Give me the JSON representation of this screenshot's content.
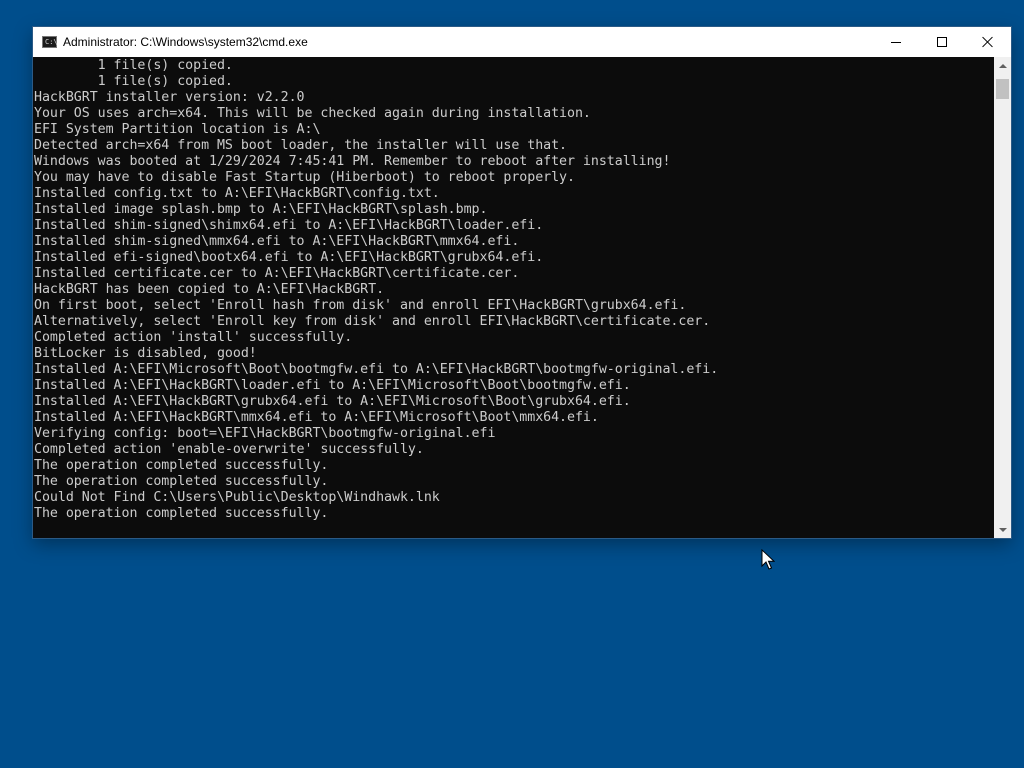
{
  "window": {
    "title": "Administrator: C:\\Windows\\system32\\cmd.exe",
    "app_icon": "command-prompt-icon",
    "icon_prompt": "C:\\",
    "buttons": {
      "minimize": "minimize-icon",
      "maximize": "maximize-icon",
      "close": "close-icon"
    }
  },
  "console": {
    "lines": [
      "        1 file(s) copied.",
      "        1 file(s) copied.",
      "HackBGRT installer version: v2.2.0",
      "Your OS uses arch=x64. This will be checked again during installation.",
      "EFI System Partition location is A:\\",
      "Detected arch=x64 from MS boot loader, the installer will use that.",
      "Windows was booted at 1/29/2024 7:45:41 PM. Remember to reboot after installing!",
      "You may have to disable Fast Startup (Hiberboot) to reboot properly.",
      "Installed config.txt to A:\\EFI\\HackBGRT\\config.txt.",
      "Installed image splash.bmp to A:\\EFI\\HackBGRT\\splash.bmp.",
      "Installed shim-signed\\shimx64.efi to A:\\EFI\\HackBGRT\\loader.efi.",
      "Installed shim-signed\\mmx64.efi to A:\\EFI\\HackBGRT\\mmx64.efi.",
      "Installed efi-signed\\bootx64.efi to A:\\EFI\\HackBGRT\\grubx64.efi.",
      "Installed certificate.cer to A:\\EFI\\HackBGRT\\certificate.cer.",
      "HackBGRT has been copied to A:\\EFI\\HackBGRT.",
      "On first boot, select 'Enroll hash from disk' and enroll EFI\\HackBGRT\\grubx64.efi.",
      "Alternatively, select 'Enroll key from disk' and enroll EFI\\HackBGRT\\certificate.cer.",
      "Completed action 'install' successfully.",
      "BitLocker is disabled, good!",
      "Installed A:\\EFI\\Microsoft\\Boot\\bootmgfw.efi to A:\\EFI\\HackBGRT\\bootmgfw-original.efi.",
      "Installed A:\\EFI\\HackBGRT\\loader.efi to A:\\EFI\\Microsoft\\Boot\\bootmgfw.efi.",
      "Installed A:\\EFI\\HackBGRT\\grubx64.efi to A:\\EFI\\Microsoft\\Boot\\grubx64.efi.",
      "Installed A:\\EFI\\HackBGRT\\mmx64.efi to A:\\EFI\\Microsoft\\Boot\\mmx64.efi.",
      "Verifying config: boot=\\EFI\\HackBGRT\\bootmgfw-original.efi",
      "Completed action 'enable-overwrite' successfully.",
      "The operation completed successfully.",
      "The operation completed successfully.",
      "Could Not Find C:\\Users\\Public\\Desktop\\Windhawk.lnk",
      "The operation completed successfully."
    ]
  },
  "scrollbar": {
    "up_icon": "scroll-up-arrow-icon",
    "down_icon": "scroll-down-arrow-icon"
  },
  "colors": {
    "desktop_background": "#004e8c",
    "console_background": "#0c0c0c",
    "console_text": "#cccccc",
    "titlebar_background": "#ffffff"
  }
}
